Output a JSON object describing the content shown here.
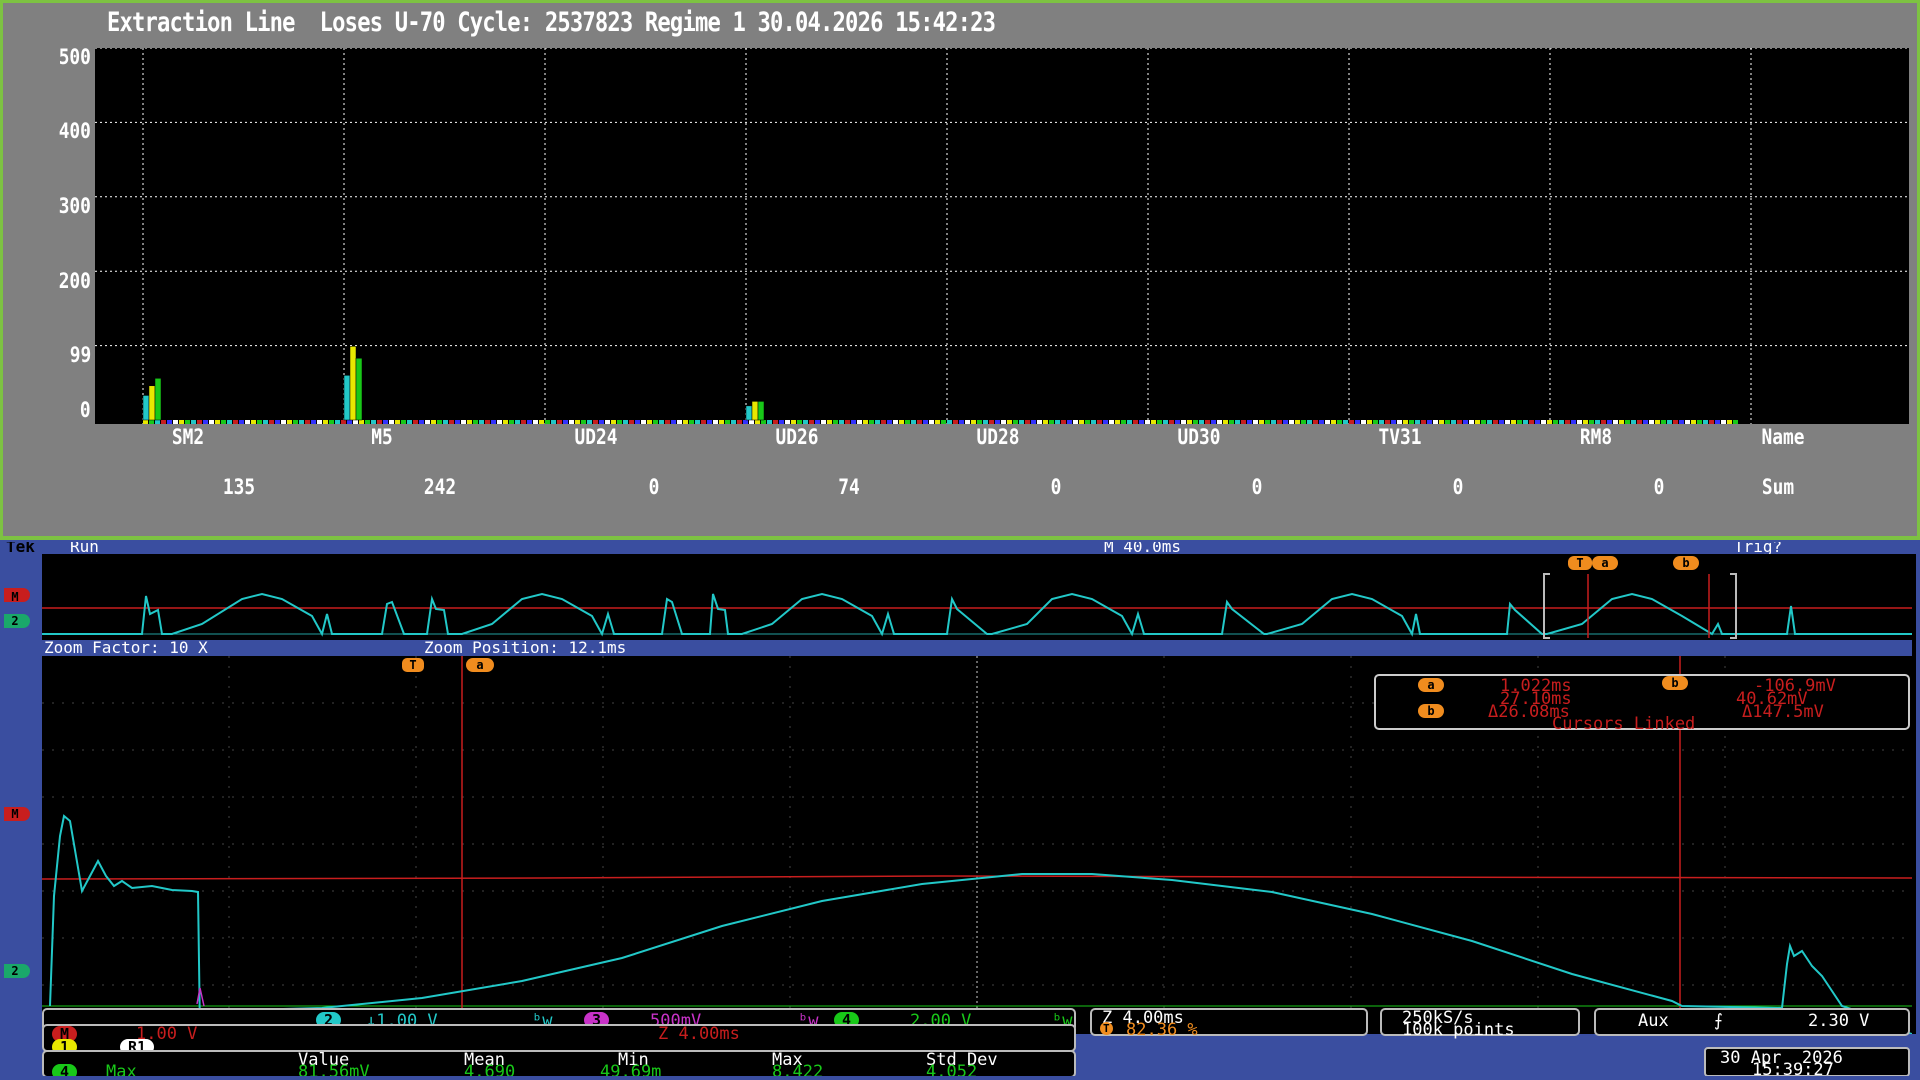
{
  "top": {
    "title": "Extraction Line  Loses U-70 Cycle: 2537823 Regime 1 30.04.2026 15:42:23",
    "yticks": [
      "500",
      "400",
      "300",
      "200",
      "99",
      "0"
    ],
    "categories": [
      "SM2",
      "M5",
      "UD24",
      "UD26",
      "UD28",
      "UD30",
      "TV31",
      "RM8",
      "Name"
    ],
    "sums": [
      "135",
      "242",
      "0",
      "74",
      "0",
      "0",
      "0",
      "0",
      "Sum"
    ]
  },
  "chart_data": {
    "type": "bar",
    "categories": [
      "SM2",
      "M5",
      "UD24",
      "UD26",
      "UD28",
      "UD30",
      "TV31",
      "RM8"
    ],
    "series": [
      {
        "values": [
          33,
          60,
          0,
          19,
          0,
          0,
          0,
          0
        ]
      },
      {
        "values": [
          46,
          99,
          0,
          25,
          0,
          0,
          0,
          0
        ]
      },
      {
        "values": [
          56,
          83,
          0,
          25,
          0,
          0,
          0,
          0
        ]
      }
    ],
    "ylim": [
      0,
      500
    ],
    "grid": true,
    "sums": [
      135,
      242,
      0,
      74,
      0,
      0,
      0,
      0
    ]
  },
  "colors": {
    "cyan": "#22c8c8",
    "yellow": "#e8e800",
    "green": "#18c818",
    "red": "#c81e1e",
    "magenta": "#c832c8",
    "orange": "#f08c1e",
    "frame": "#3a4ea0"
  },
  "scope": {
    "tek": "Tek",
    "run_state": "Run",
    "timebase": "M 40.0ms",
    "trig_status": "Trig?",
    "zoom_factor": "Zoom Factor: 10 X",
    "zoom_position": "Zoom Position: 12.1ms",
    "markers": {
      "m": "M",
      "ch2": "2",
      "t": "T",
      "a": "a",
      "b": "b"
    },
    "cursor_readout": {
      "a_time": "1.022ms",
      "a_volt": "-106.9mV",
      "b_time": "27.10ms",
      "b_volt": "40.62mV",
      "delta_time": "Δ26.08ms",
      "delta_volt": "Δ147.5mV",
      "link": "Cursors Linked"
    },
    "channels": {
      "ch2_num": "2",
      "ch2": "↓1.00 V",
      "ch2_bw": "ᵇw",
      "ch3_num": "3",
      "ch3": "500mV",
      "ch3_bw": "ᵇw",
      "ch4_num": "4",
      "ch4": "2.00 V",
      "ch4_bw": "ᵇw",
      "math_num": "M",
      "math": "1.00 V",
      "math_zoom": "Z 4.00ms",
      "ref1": "1",
      "ref_r1": "R1"
    },
    "zoom_box": {
      "z": "Z 4.00ms",
      "pct": "82.36 %",
      "t": "T"
    },
    "rate_box": {
      "rate": "250kS/s",
      "points": "100k points"
    },
    "trigger_box": {
      "source": "Aux",
      "slope": "⨍",
      "level": "2.30 V"
    },
    "measure": {
      "headers": [
        "Value",
        "Mean",
        "Min",
        "Max",
        "Std Dev"
      ],
      "channel": "4",
      "name": "Max",
      "value": "81.56mV",
      "mean": "4.690",
      "min": "49.69m",
      "max": "8.422",
      "std": "4.052"
    },
    "date": "30 Apr  2026",
    "time": "15:39:27"
  }
}
